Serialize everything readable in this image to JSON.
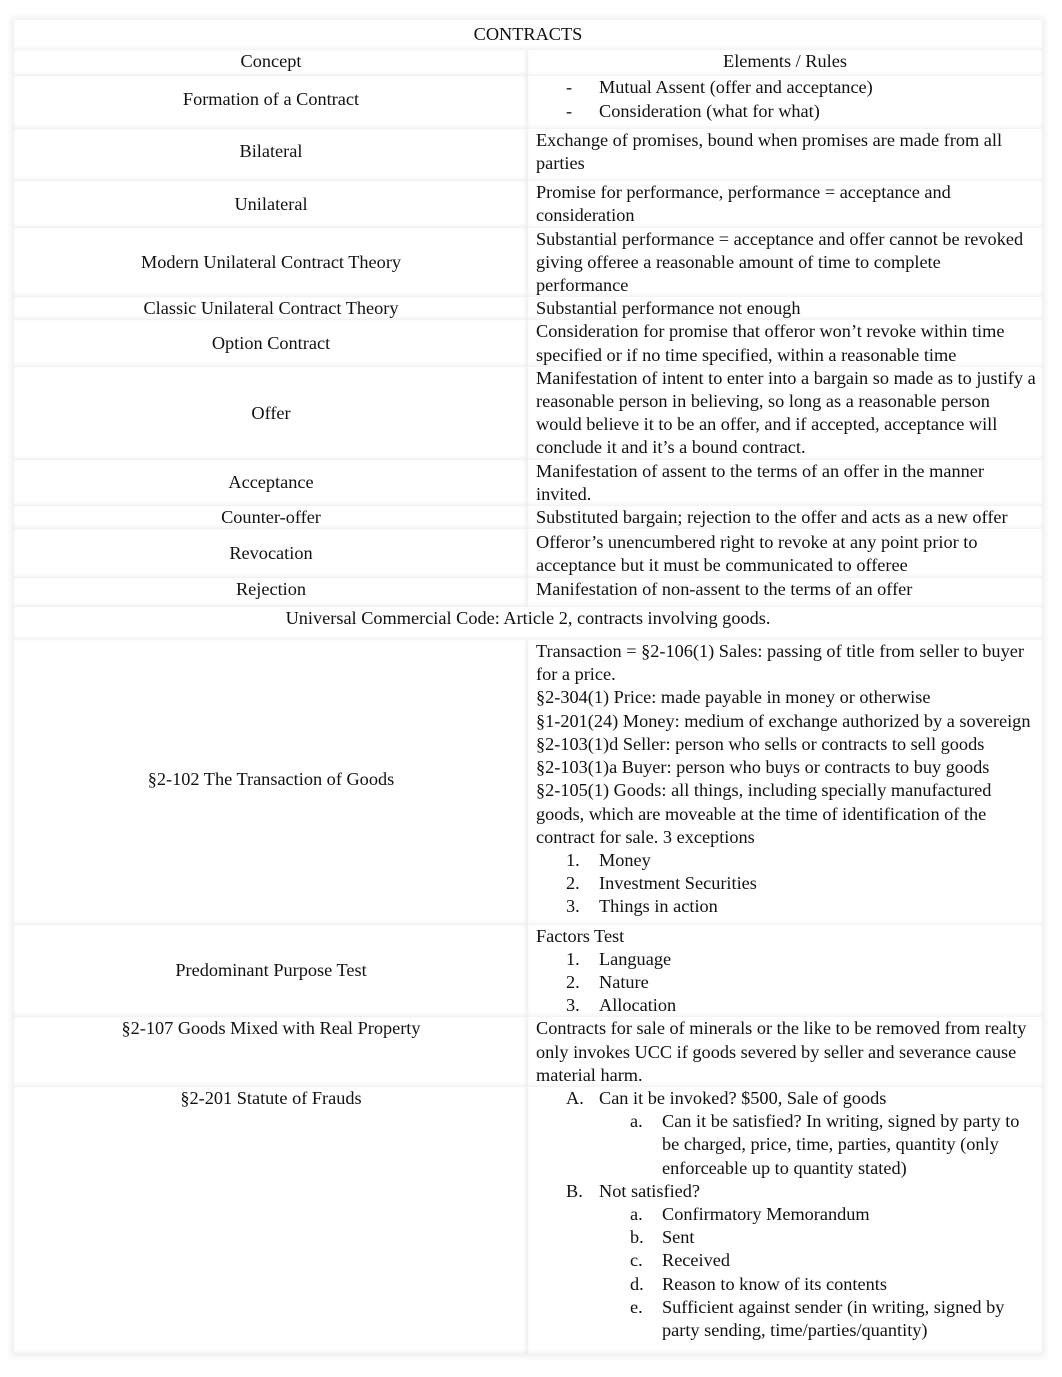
{
  "document": {
    "title": "CONTRACTS",
    "headers": {
      "concept": "Concept",
      "rules": "Elements / Rules"
    },
    "rows": {
      "formation": {
        "concept": "Formation of a Contract",
        "items": [
          {
            "marker": "-",
            "text": "Mutual Assent (offer and acceptance)"
          },
          {
            "marker": "-",
            "text": "Consideration (what for what)"
          }
        ]
      },
      "bilateral": {
        "concept": "Bilateral",
        "text": "Exchange of promises, bound when promises are made from all parties"
      },
      "unilateral": {
        "concept": "Unilateral",
        "text": "Promise for performance, performance = acceptance and consideration"
      },
      "modern": {
        "concept": "Modern Unilateral Contract Theory",
        "text": "Substantial performance = acceptance and offer cannot be revoked giving offeree a reasonable amount of time to complete performance"
      },
      "classic": {
        "concept": "Classic Unilateral Contract Theory",
        "text": "Substantial performance not enough"
      },
      "option": {
        "concept": "Option Contract",
        "text": "Consideration for promise that offeror won’t revoke within time specified or if no time specified, within a reasonable time"
      },
      "offer": {
        "concept": "Offer",
        "text": "Manifestation of intent to enter into a bargain so made as to justify a reasonable person in believing, so long as a reasonable person would believe it to be an offer, and if accepted, acceptance will conclude it and it’s a bound contract."
      },
      "acceptance": {
        "concept": "Acceptance",
        "text": "Manifestation of assent to the terms of an offer in the manner invited."
      },
      "counter": {
        "concept": "Counter-offer",
        "text": "Substituted bargain; rejection to the offer and acts as a new offer"
      },
      "revocation": {
        "concept": "Revocation",
        "text": "Offeror’s unencumbered right to revoke at any point prior to acceptance but it must be communicated to offeree"
      },
      "rejection": {
        "concept": "Rejection",
        "text": "Manifestation of non-assent to the terms of an offer"
      },
      "ucc_heading": "Universal Commercial Code: Article 2, contracts involving goods.",
      "s2102": {
        "concept": "§2-102 The Transaction of Goods",
        "lines": [
          "Transaction = §2-106(1) Sales: passing of title from seller to buyer for a price.",
          "§2-304(1) Price: made payable in money or otherwise",
          "§1-201(24) Money: medium of exchange authorized by a sovereign",
          "§2-103(1)d Seller: person who sells or contracts to sell goods",
          "§2-103(1)a Buyer: person who buys or contracts to buy goods",
          "§2-105(1) Goods: all things, including specially manufactured goods, which are moveable at the time of identification of the contract for sale. 3 exceptions"
        ],
        "items": [
          {
            "marker": "1.",
            "text": "Money"
          },
          {
            "marker": "2.",
            "text": "Investment Securities"
          },
          {
            "marker": "3.",
            "text": "Things in action"
          }
        ]
      },
      "predominant": {
        "concept": "Predominant Purpose Test",
        "intro": "Factors Test",
        "items": [
          {
            "marker": "1.",
            "text": "Language"
          },
          {
            "marker": "2.",
            "text": "Nature"
          },
          {
            "marker": "3.",
            "text": "Allocation"
          }
        ]
      },
      "s2107": {
        "concept": "§2-107 Goods Mixed with Real Property",
        "text": "Contracts for sale of minerals or the like to be removed from realty only invokes UCC if goods severed by seller and severance cause material harm."
      },
      "s2201": {
        "concept": "§2-201 Statute of Frauds",
        "a": {
          "marker": "A.",
          "text": "Can it be invoked? $500, Sale of goods",
          "sub": [
            {
              "marker": "a.",
              "text": "Can it be satisfied? In writing, signed by party to be charged, price, time, parties, quantity (only enforceable up to quantity stated)"
            }
          ]
        },
        "b": {
          "marker": "B.",
          "text": "Not satisfied?",
          "sub": [
            {
              "marker": "a.",
              "text": "Confirmatory Memorandum"
            },
            {
              "marker": "b.",
              "text": "Sent"
            },
            {
              "marker": "c.",
              "text": "Received"
            },
            {
              "marker": "d.",
              "text": "Reason to know of its contents"
            },
            {
              "marker": "e.",
              "text": "Sufficient against sender (in writing, signed by party sending, time/parties/quantity)"
            }
          ]
        }
      }
    }
  }
}
